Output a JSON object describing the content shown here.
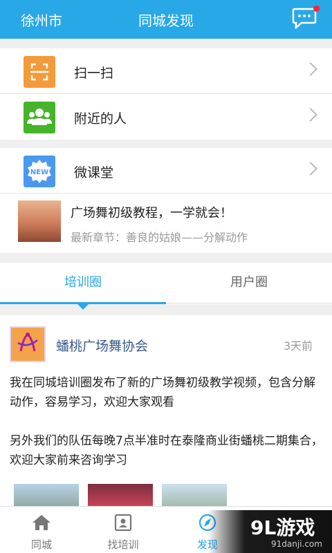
{
  "header": {
    "city": "徐州市",
    "title": "同城发现",
    "accent": "#29a8e8",
    "badge_color": "#ff2a3d",
    "message_icon": "chat-bubble-icon"
  },
  "menu": {
    "group1": [
      {
        "label": "扫一扫",
        "icon": "scan-icon",
        "icon_color": "#f39a3b"
      },
      {
        "label": "附近的人",
        "icon": "people-icon",
        "icon_color": "#45b32b"
      }
    ],
    "group2": [
      {
        "label": "微课堂",
        "icon": "new-badge-icon",
        "icon_color": "#4a99ef"
      }
    ]
  },
  "course": {
    "title": "广场舞初级教程，一学就会！",
    "subtitle": "最新章节：善良的姑娘——分解动作"
  },
  "tabs": {
    "active": "培训圈",
    "items": [
      "培训圈",
      "用户圈"
    ]
  },
  "post": {
    "org": "蟠桃广场舞协会",
    "time": "3天前",
    "paragraph1": "我在同城培训圈发布了新的广场舞初级教学视频，包含分解动作，容易学习，欢迎大家观看",
    "paragraph2": "另外我们的队伍每晚7点半准时在泰隆商业街蟠桃二期集合，欢迎大家前来咨询学习"
  },
  "bottom_nav": [
    {
      "label": "同城",
      "icon": "home-icon"
    },
    {
      "label": "找培训",
      "icon": "id-card-icon"
    },
    {
      "label": "发现",
      "icon": "compass-icon"
    },
    {
      "label": "",
      "icon": "person-icon"
    }
  ],
  "watermark": {
    "brand": "9L游戏",
    "domain": "91danji.com"
  }
}
